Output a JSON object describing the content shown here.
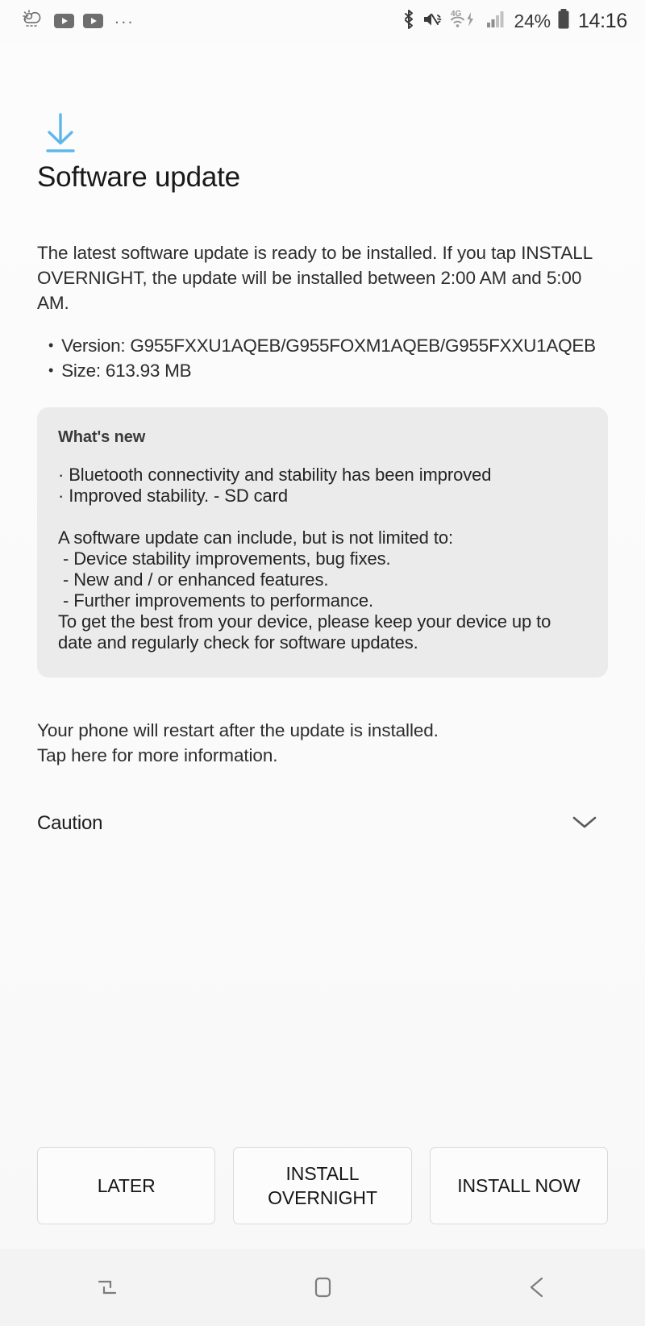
{
  "status_bar": {
    "left_icons": [
      "weather-partly-sunny-icon",
      "youtube-icon",
      "youtube-icon",
      "more-notifications-dots"
    ],
    "more_dots": "...",
    "right_icons": [
      "bluetooth-icon",
      "sound-mute-vibrate-icon",
      "wifi-4g-icon",
      "cellular-signal-icon"
    ],
    "network_label": "4G",
    "battery_percent": "24%",
    "clock": "14:16"
  },
  "header": {
    "icon": "download-arrow-icon",
    "title": "Software update",
    "icon_color": "#5db8e8"
  },
  "main": {
    "intro": "The latest software update is ready to be installed. If you tap INSTALL OVERNIGHT, the update will be installed between 2:00 AM and 5:00 AM.",
    "meta": [
      "Version: G955FXXU1AQEB/G955FOXM1AQEB/G955FXXU1AQEB",
      "Size: 613.93 MB"
    ],
    "whats_new": {
      "title": "What's new",
      "body": "· Bluetooth connectivity and stability has been improved\n· Improved stability. - SD card\n\nA software update can include, but is not limited to:\n - Device stability improvements, bug fixes.\n - New and / or enhanced features.\n - Further improvements to performance.\nTo get the best from your device, please keep your device up to date and regularly check for software updates."
    },
    "restart_note": "Your phone will restart after the update is installed.\nTap here for more information.",
    "caution": {
      "label": "Caution",
      "expand_icon": "chevron-down-icon"
    }
  },
  "actions": {
    "later": "LATER",
    "install_overnight": "INSTALL\nOVERNIGHT",
    "install_now": "INSTALL NOW"
  },
  "nav_bar": {
    "recents": "recents-icon",
    "home": "home-icon",
    "back": "back-icon"
  }
}
